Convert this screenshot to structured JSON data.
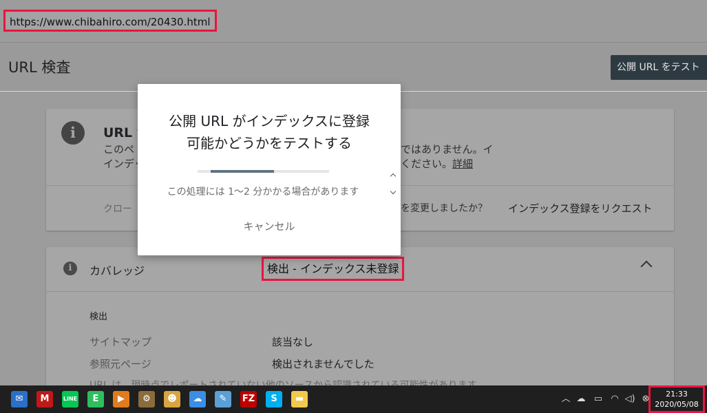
{
  "url_bar": {
    "url": "https://www.chibahiro.com/20430.html"
  },
  "header": {
    "title": "URL 検査",
    "test_button": "公開 URL をテスト"
  },
  "card1": {
    "title": "URL が",
    "body_left_1": "このペ",
    "body_left_2": "インデッ",
    "body_right_1": "ではありません。イ",
    "body_right_2": "ください。",
    "detail_link": "詳細",
    "crawl_left": "クロー",
    "crawl_right": "を変更しましたか？",
    "request_link": "インデックス登録をリクエスト"
  },
  "coverage": {
    "label": "カバレッジ",
    "status": "検出 - インデックス未登録",
    "section": "検出",
    "rows": [
      {
        "label": "サイトマップ",
        "value": "該当なし"
      },
      {
        "label": "参照元ページ",
        "value": "検出されませんでした"
      }
    ],
    "note": "URL は、現時点でレポートされていない他のソースから認識されている可能性があります"
  },
  "modal": {
    "title_line1": "公開 URL がインデックスに登録",
    "title_line2": "可能かどうかをテストする",
    "progress_fraction": 0.6,
    "note": "この処理には 1〜2 分かかる場合があります",
    "cancel": "キャンセル"
  },
  "taskbar": {
    "apps": [
      {
        "name": "thunderbird-icon",
        "glyph": "✉",
        "color": "#2a6fc9"
      },
      {
        "name": "mcafee-icon",
        "glyph": "M",
        "color": "#c01818"
      },
      {
        "name": "line-icon",
        "glyph": "LINE",
        "color": "#06c755"
      },
      {
        "name": "evernote-icon",
        "glyph": "E",
        "color": "#2dbe60"
      },
      {
        "name": "media-player-icon",
        "glyph": "▶",
        "color": "#e07b1f"
      },
      {
        "name": "tool-icon",
        "glyph": "⚙",
        "color": "#8a6d3b"
      },
      {
        "name": "face-app-icon",
        "glyph": "☻",
        "color": "#d9a441"
      },
      {
        "name": "file-transfer-icon",
        "glyph": "☁",
        "color": "#3a8ee6"
      },
      {
        "name": "notepad-icon",
        "glyph": "✎",
        "color": "#5aa0d6"
      },
      {
        "name": "filezilla-icon",
        "glyph": "FZ",
        "color": "#bf0000"
      },
      {
        "name": "skype-icon",
        "glyph": "S",
        "color": "#00aff0"
      },
      {
        "name": "file-explorer-icon",
        "glyph": "▬",
        "color": "#f2c94c"
      }
    ],
    "tray_icons": [
      "chevron-up-icon",
      "onedrive-icon",
      "battery-icon",
      "wifi-icon",
      "volume-icon",
      "notification-icon"
    ],
    "time": "21:33",
    "date": "2020/05/08"
  }
}
